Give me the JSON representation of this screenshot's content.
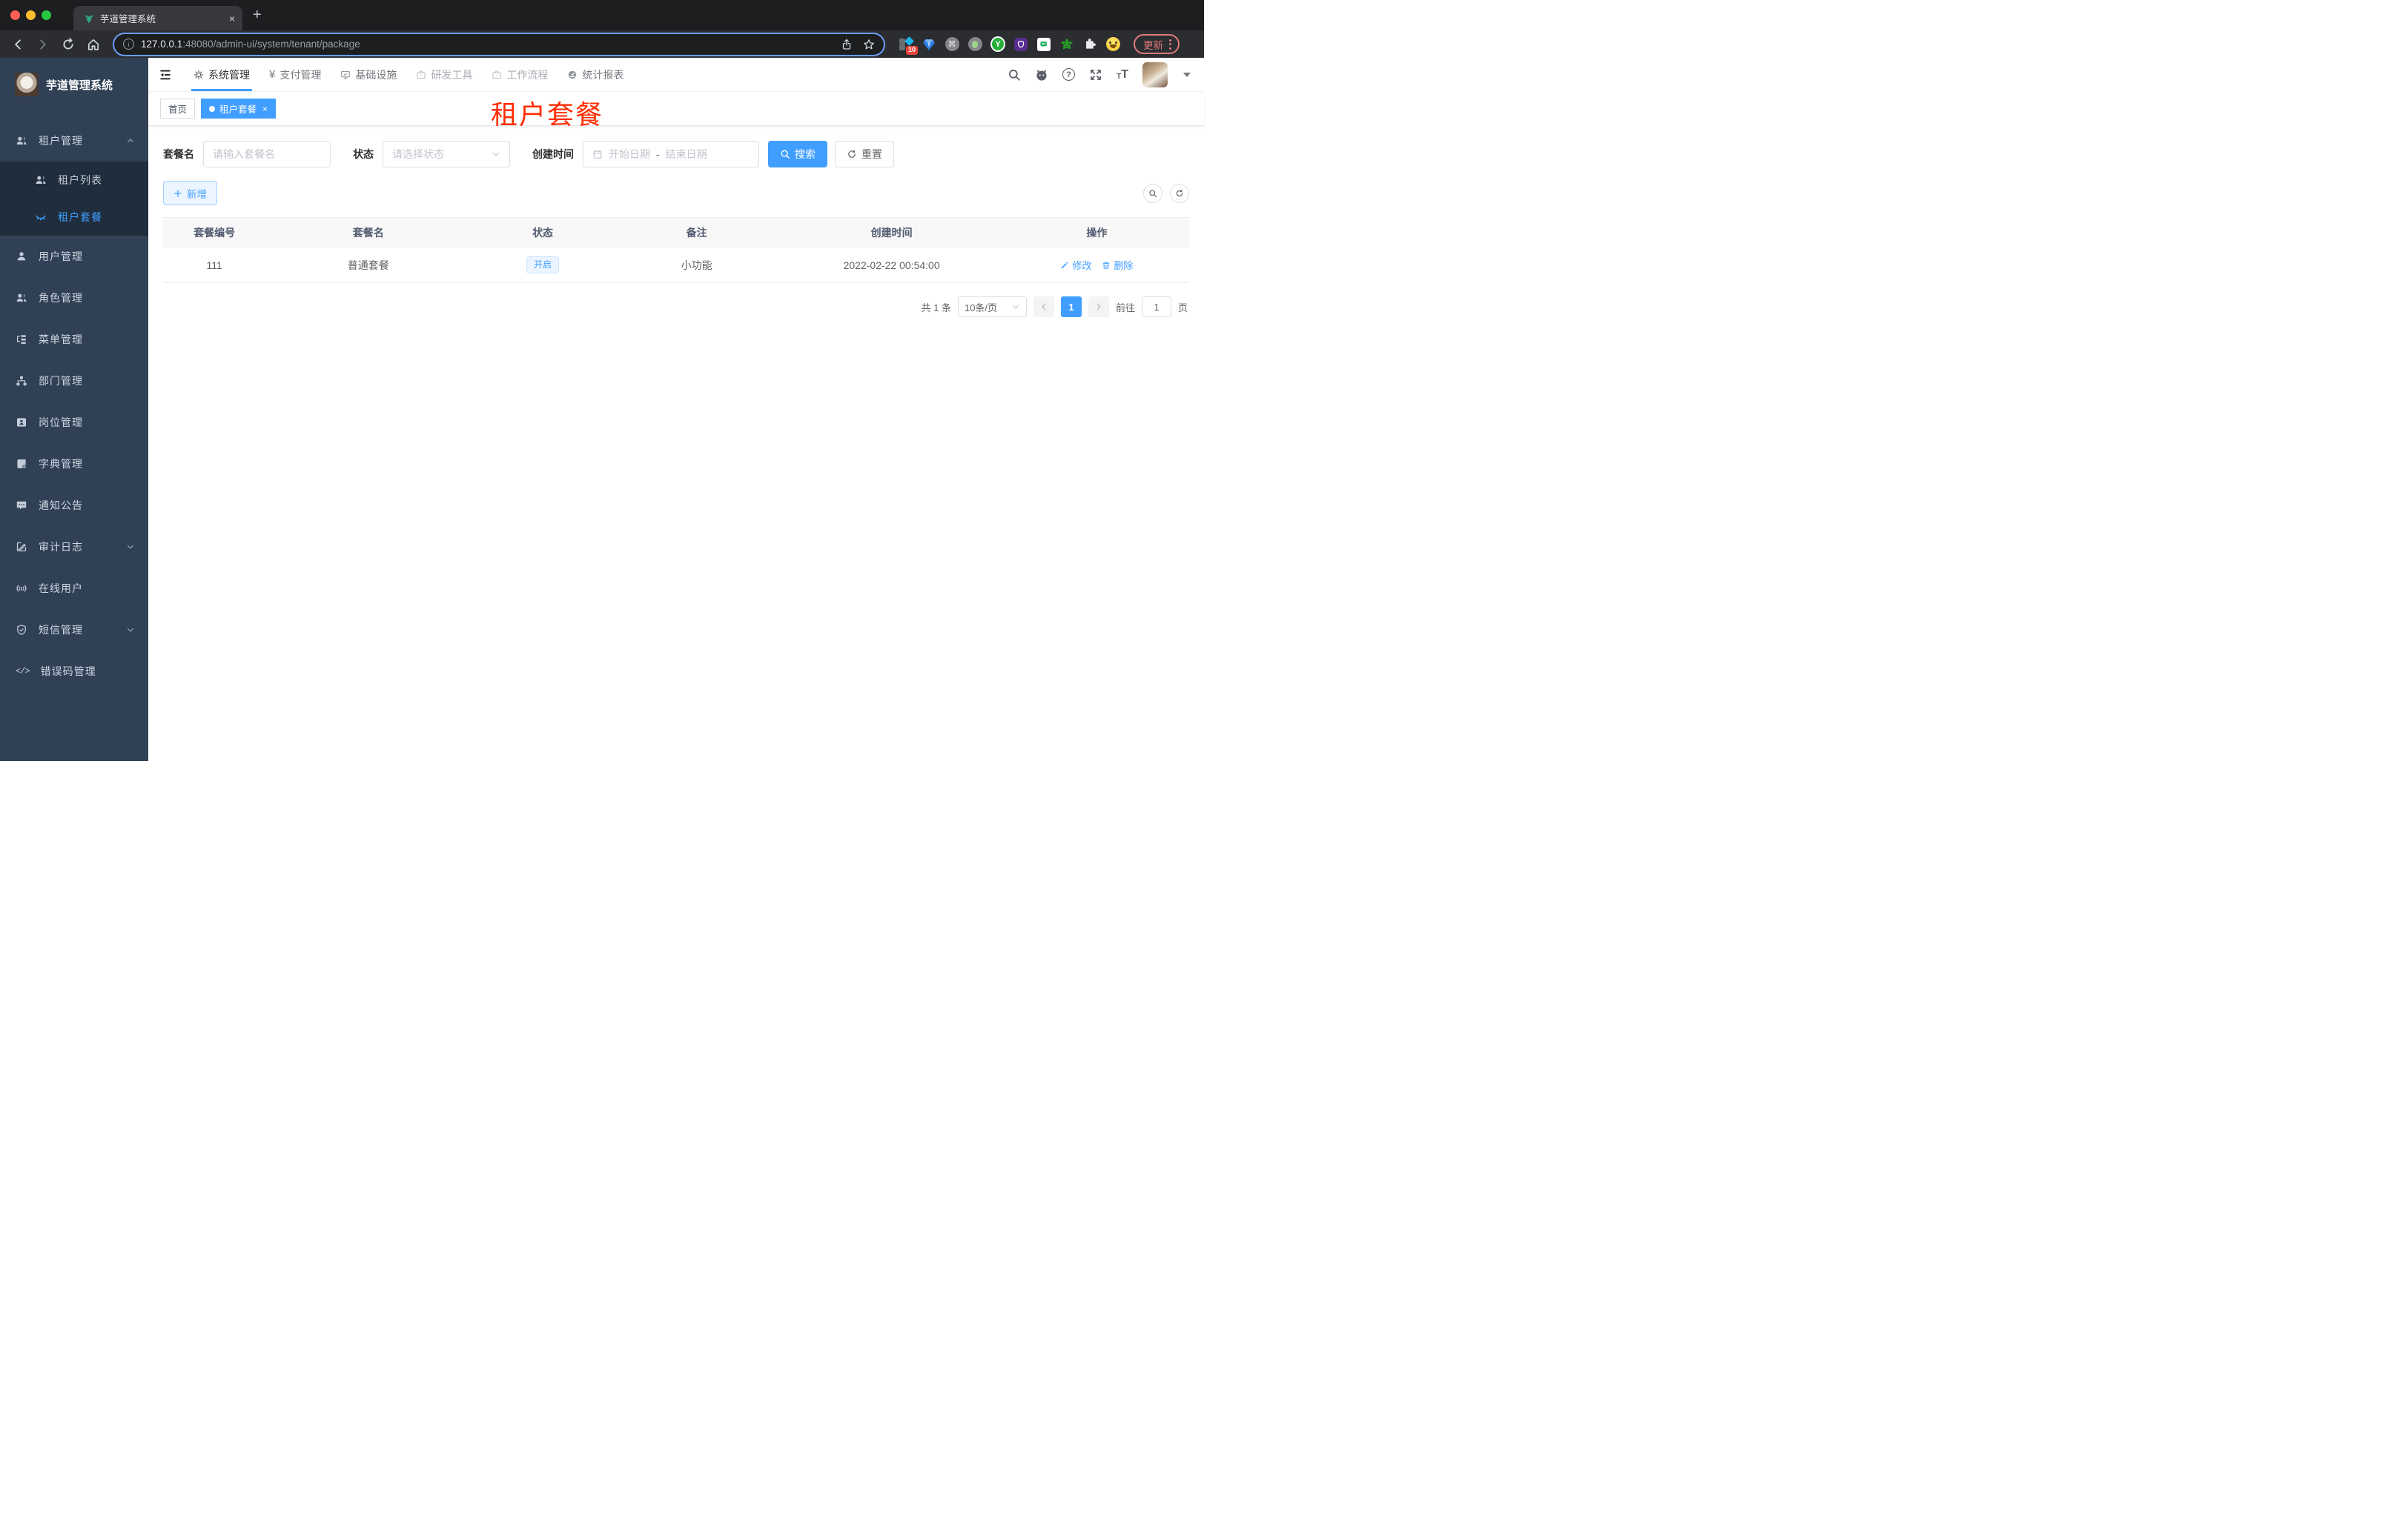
{
  "browser": {
    "tab_title": "芋道管理系统",
    "url_host": "127.0.0.1",
    "url_path": ":48080/admin-ui/system/tenant/package",
    "extension_badge": "10",
    "update_label": "更新"
  },
  "icons": {
    "yen": "¥",
    "command": "⌘",
    "code": "</>",
    "y_letter": "Y",
    "question": "?",
    "info": "i",
    "close": "×",
    "t_letter": "T"
  },
  "sidebar": {
    "title": "芋道管理系统",
    "menu": [
      {
        "label": "租户管理"
      },
      {
        "label": "租户列表"
      },
      {
        "label": "租户套餐"
      },
      {
        "label": "用户管理"
      },
      {
        "label": "角色管理"
      },
      {
        "label": "菜单管理"
      },
      {
        "label": "部门管理"
      },
      {
        "label": "岗位管理"
      },
      {
        "label": "字典管理"
      },
      {
        "label": "通知公告"
      },
      {
        "label": "审计日志"
      },
      {
        "label": "在线用户"
      },
      {
        "label": "短信管理"
      },
      {
        "label": "错误码管理"
      }
    ]
  },
  "header": {
    "nav": [
      {
        "label": "系统管理"
      },
      {
        "label": "支付管理"
      },
      {
        "label": "基础设施"
      },
      {
        "label": "研发工具"
      },
      {
        "label": "工作流程"
      },
      {
        "label": "统计报表"
      }
    ]
  },
  "tags": {
    "tabs": [
      {
        "label": "首页"
      },
      {
        "label": "租户套餐"
      }
    ]
  },
  "page_title": "租户套餐",
  "filters": {
    "name_label": "套餐名",
    "name_placeholder": "请输入套餐名",
    "status_label": "状态",
    "status_placeholder": "请选择状态",
    "date_label": "创建时间",
    "date_start_placeholder": "开始日期",
    "date_separator": "-",
    "date_end_placeholder": "结束日期",
    "search_label": "搜索",
    "reset_label": "重置"
  },
  "toolbar": {
    "add_label": "新增"
  },
  "table": {
    "columns": [
      "套餐编号",
      "套餐名",
      "状态",
      "备注",
      "创建时间",
      "操作"
    ],
    "rows": [
      {
        "id": "111",
        "name": "普通套餐",
        "status": "开启",
        "remark": "小功能",
        "created_at": "2022-02-22 00:54:00",
        "action_edit": "修改",
        "action_delete": "删除"
      }
    ]
  },
  "pagination": {
    "total": "共 1 条",
    "page_size": "10条/页",
    "current_page": "1",
    "goto_label": "前往",
    "goto_value": "1",
    "page_unit": "页"
  },
  "colors": {
    "accent": "#409EFF",
    "title_red": "#ff2d00",
    "sidebar_bg": "#304156",
    "submenu_bg": "#1f2d3d"
  }
}
